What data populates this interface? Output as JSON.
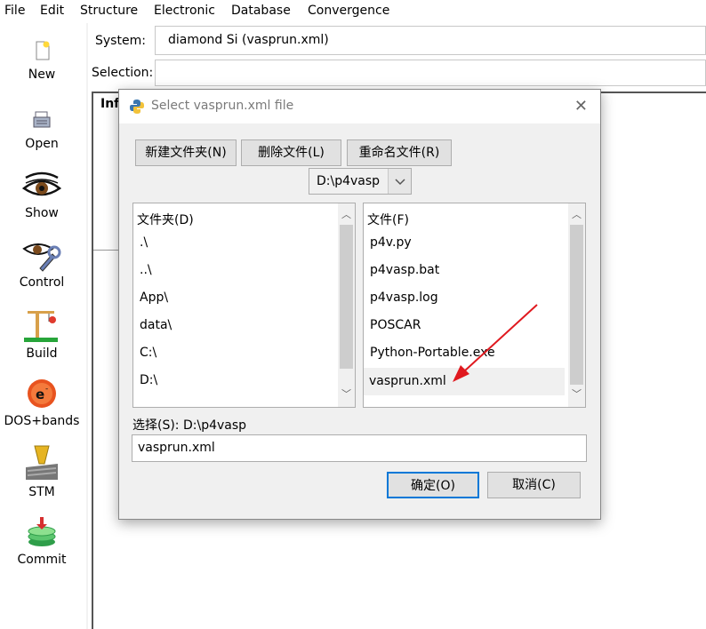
{
  "menubar": {
    "items": [
      "File",
      "Edit",
      "Structure",
      "Electronic",
      "Database",
      "Convergence"
    ]
  },
  "toolbar": {
    "items": [
      {
        "label": "New",
        "icon": "new-file-icon"
      },
      {
        "label": "Open",
        "icon": "open-icon"
      },
      {
        "label": "Show",
        "icon": "eye-icon"
      },
      {
        "label": "Control",
        "icon": "control-icon"
      },
      {
        "label": "Build",
        "icon": "build-crane-icon"
      },
      {
        "label": "DOS+bands",
        "icon": "electron-icon"
      },
      {
        "label": "STM",
        "icon": "stm-icon"
      },
      {
        "label": "Commit",
        "icon": "commit-icon"
      }
    ]
  },
  "main": {
    "system_label": "System:",
    "system_value": "diamond Si (vasprun.xml)",
    "selection_label": "Selection:",
    "selection_value": "",
    "info_label": "Info"
  },
  "dialog": {
    "title": "Select vasprun.xml file",
    "buttons": {
      "new_folder": "新建文件夹(N)",
      "delete_file": "删除文件(L)",
      "rename_file": "重命名文件(R)"
    },
    "path_combo": "D:\\p4vasp",
    "folders_header": "文件夹(D)",
    "folders": [
      ".\\",
      "..\\",
      "App\\",
      "data\\",
      "C:\\",
      "D:\\"
    ],
    "files_header": "文件(F)",
    "files": [
      "p4v.py",
      "p4vasp.bat",
      "p4vasp.log",
      "POSCAR",
      "Python-Portable.exe",
      "vasprun.xml"
    ],
    "selected_file": "vasprun.xml",
    "selection_caption": "选择(S):  D:\\p4vasp",
    "filename_input": "vasprun.xml",
    "ok_label": "确定(O)",
    "cancel_label": "取消(C)"
  },
  "colors": {
    "annotation_arrow": "#e0191f",
    "ok_focus": "#0078d7"
  }
}
